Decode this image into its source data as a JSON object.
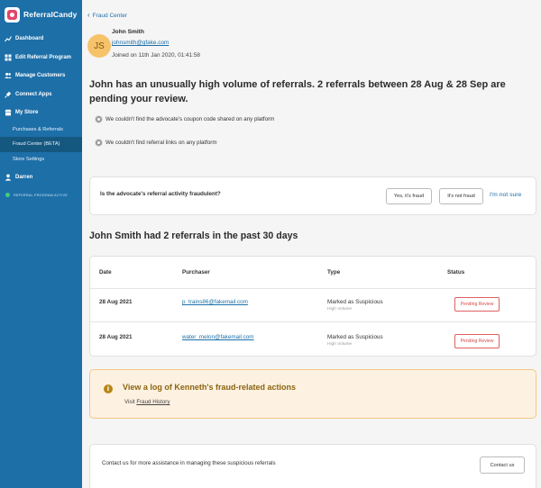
{
  "brand": {
    "name": "ReferralCandy"
  },
  "sidebar": {
    "items": [
      {
        "label": "Dashboard",
        "icon": "chart-icon"
      },
      {
        "label": "Edit Referral Program",
        "icon": "grid-icon"
      },
      {
        "label": "Manage Customers",
        "icon": "users-icon"
      },
      {
        "label": "Connect Apps",
        "icon": "plug-icon"
      },
      {
        "label": "My Store",
        "icon": "store-icon"
      }
    ],
    "subitems": [
      {
        "label": "Purchases & Referrals",
        "active": false
      },
      {
        "label": "Fraud Center (BETA)",
        "active": true
      },
      {
        "label": "Store Settings",
        "active": false
      }
    ],
    "user": {
      "label": "Darren",
      "icon": "person-icon"
    },
    "program_status": {
      "label": "REFERRAL PROGRAM ACTIVE",
      "color": "#3ecf7a"
    }
  },
  "breadcrumb": {
    "back_label": "Fraud Center"
  },
  "advocate": {
    "initials": "JS",
    "name": "John Smith",
    "email": "johnsmith@gfake.com",
    "joined": "Joined on 11th Jan 2020, 01:41:58"
  },
  "headline": "John has an unusually high volume of referrals. 2 referrals between 28 Aug & 28 Sep are pending your review.",
  "reasons": [
    "We couldn't find the advocate's coupon code shared on any platform",
    "We couldn't find referral links on any platform"
  ],
  "question": {
    "text": "Is the advocate's referral activity fraudulent?",
    "yes_label": "Yes, it's fraud",
    "no_label": "It's not fraud",
    "unsure_label": "I'm not sure"
  },
  "referrals": {
    "title": "John Smith had 2 referrals in the past 30 days",
    "columns": [
      "Date",
      "Purchaser",
      "Type",
      "Status"
    ],
    "rows": [
      {
        "date": "28 Aug 2021",
        "purchaser": "p_trains86@fakemail.com",
        "type": "Marked as Suspicious",
        "type_sub": "High Volume",
        "status": "Pending Review"
      },
      {
        "date": "28 Aug 2021",
        "purchaser": "water_melon@fakemail.com",
        "type": "Marked as Suspicious",
        "type_sub": "High Volume",
        "status": "Pending Review"
      }
    ]
  },
  "log": {
    "title": "View a log of Kenneth's fraud-related actions",
    "visit_prefix": "Visit",
    "visit_link": "Fraud History"
  },
  "contact": {
    "text": "Contact us for more assistance in managing these suspicious referrals",
    "button_label": "Contact us"
  },
  "colors": {
    "sidebar_bg": "#1d6fa8",
    "accent": "#1d6fa8",
    "pending": "#d94a4a",
    "log_bg": "#fdf1e1",
    "log_title": "#8b6410"
  }
}
